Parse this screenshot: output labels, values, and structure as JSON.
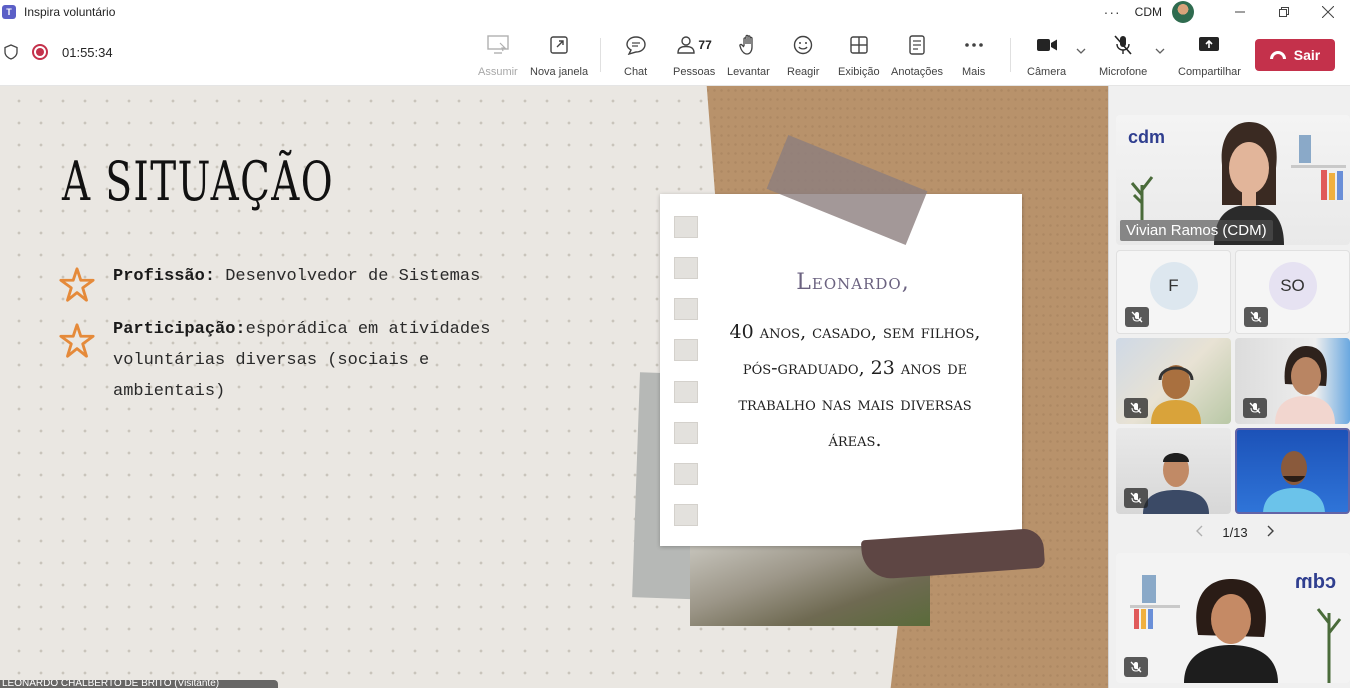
{
  "window": {
    "title": "Inspira voluntário",
    "org": "CDM"
  },
  "toolbar": {
    "timer": "01:55:34",
    "people_count": "77",
    "buttons": {
      "assumir": "Assumir",
      "nova_janela": "Nova janela",
      "chat": "Chat",
      "pessoas": "Pessoas",
      "levantar": "Levantar",
      "reagir": "Reagir",
      "exibicao": "Exibição",
      "anotacoes": "Anotações",
      "mais": "Mais",
      "camera": "Câmera",
      "microfone": "Microfone",
      "compartilhar": "Compartilhar"
    },
    "leave_label": "Sair",
    "colors": {
      "leave": "#c4314b",
      "recording": "#c4314b"
    }
  },
  "slide": {
    "title": "A SITUAÇÃO",
    "bullets": [
      {
        "label": "Profissão:",
        "text": " Desenvolvedor de Sistemas"
      },
      {
        "label": "Participação:",
        "text": "esporádica em atividades voluntárias diversas (sociais e ambientais)"
      }
    ],
    "note_name": "Leonardo,",
    "note_body": "40 anos, casado, sem filhos, pós-graduado, 23 anos de trabalho nas mais diversas áreas."
  },
  "presenter_label": "LEONARDO CHALBERTO DE BRITO (Visitante)",
  "participants": {
    "featured": {
      "name": "Vivian Ramos (CDM)",
      "logo": "cdm"
    },
    "tiles": [
      {
        "initials": "F",
        "muted": true
      },
      {
        "initials": "SO",
        "muted": true
      },
      {
        "type": "video",
        "muted": true
      },
      {
        "type": "video",
        "muted": true
      },
      {
        "type": "video",
        "muted": true
      },
      {
        "type": "video",
        "muted": false,
        "active_speaker": true
      }
    ],
    "pager": "1/13",
    "bottom_logo": "cdm"
  }
}
